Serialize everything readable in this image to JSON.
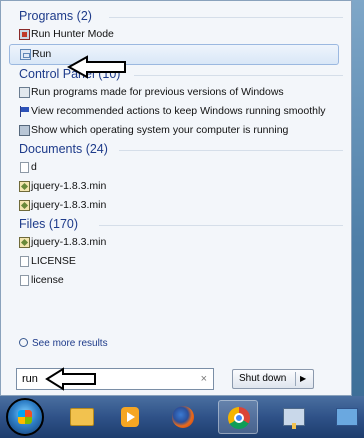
{
  "start_menu": {
    "categories": [
      {
        "header": "Programs (2)",
        "items": [
          {
            "label": "Run Hunter Mode",
            "icon": "hunter-mode-icon"
          },
          {
            "label": "Run",
            "icon": "run-icon",
            "highlighted": true
          }
        ]
      },
      {
        "header": "Control Panel (10)",
        "items": [
          {
            "label": "Run programs made for previous versions of Windows",
            "icon": "compatibility-icon"
          },
          {
            "label": "View recommended actions to keep Windows running smoothly",
            "icon": "action-center-flag-icon"
          },
          {
            "label": "Show which operating system your computer is running",
            "icon": "system-info-icon"
          }
        ]
      },
      {
        "header": "Documents (24)",
        "items": [
          {
            "label": "d",
            "icon": "document-icon"
          },
          {
            "label": "jquery-1.8.3.min",
            "icon": "script-file-icon"
          },
          {
            "label": "jquery-1.8.3.min",
            "icon": "script-file-icon"
          }
        ]
      },
      {
        "header": "Files (170)",
        "items": [
          {
            "label": "jquery-1.8.3.min",
            "icon": "script-file-icon"
          },
          {
            "label": "LICENSE",
            "icon": "document-icon"
          },
          {
            "label": "license",
            "icon": "document-icon"
          }
        ]
      }
    ],
    "see_more": "See more results",
    "search": {
      "value": "run",
      "clear_glyph": "×"
    },
    "shutdown": {
      "label": "Shut down",
      "chevron": "▶"
    }
  },
  "taskbar": {
    "buttons": [
      "start-orb",
      "windows-explorer",
      "media-player",
      "firefox",
      "chrome",
      "network",
      "display"
    ]
  },
  "colors": {
    "header": "#1e3b8a",
    "highlight_border": "#9bb8e0",
    "taskbar": "#2f5288"
  }
}
